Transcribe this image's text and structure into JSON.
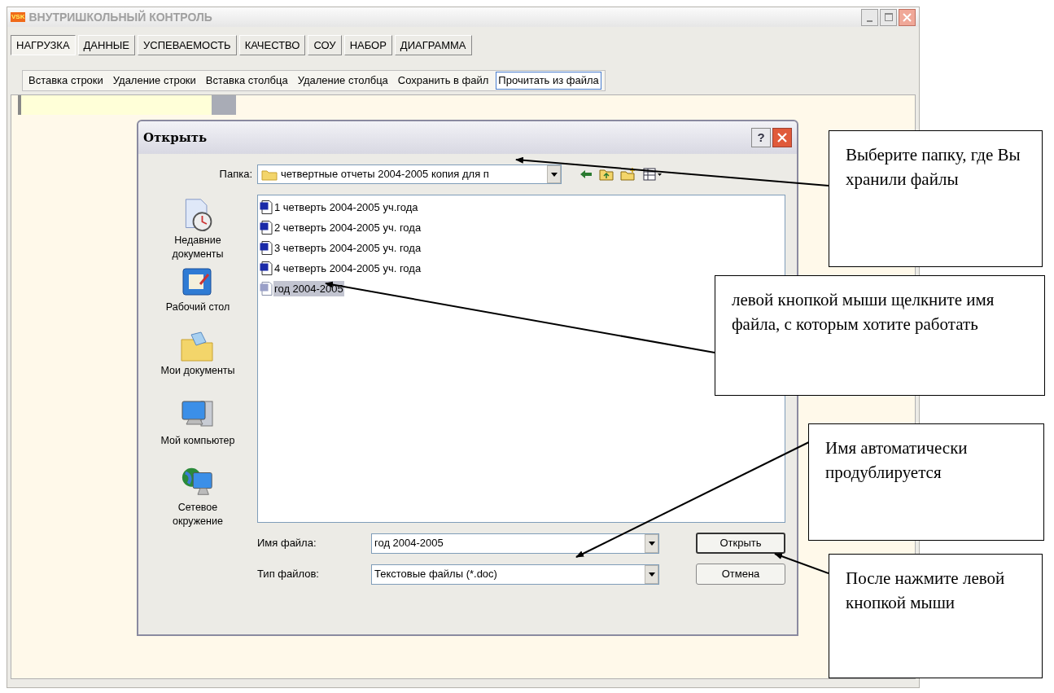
{
  "app": {
    "logo": "VSK",
    "title": "ВНУТРИШКОЛЬНЫЙ КОНТРОЛЬ",
    "tabs": [
      {
        "label": "НАГРУЗКА",
        "selected": true
      },
      {
        "label": "ДАННЫЕ",
        "selected": false
      },
      {
        "label": "УСПЕВАЕМОСТЬ",
        "selected": false
      },
      {
        "label": "КАЧЕСТВО",
        "selected": false
      },
      {
        "label": "СОУ",
        "selected": false
      },
      {
        "label": "НАБОР",
        "selected": false
      },
      {
        "label": "ДИАГРАММА",
        "selected": false
      }
    ],
    "toolbar": [
      {
        "label": "Вставка строки",
        "selected": false
      },
      {
        "label": "Удаление строки",
        "selected": false
      },
      {
        "label": "Вставка столбца",
        "selected": false
      },
      {
        "label": "Удаление столбца",
        "selected": false
      },
      {
        "label": "Сохранить в файл",
        "selected": false
      },
      {
        "label": "Прочитать из файла",
        "selected": true
      }
    ]
  },
  "dialog": {
    "title": "Открыть",
    "help": "?",
    "folder_label": "Папка:",
    "folder": "четвертные отчеты 2004-2005 копия для п",
    "places": [
      {
        "kind": "recent",
        "label": "Недавние документы"
      },
      {
        "kind": "desktop",
        "label": "Рабочий стол"
      },
      {
        "kind": "documents",
        "label": "Мои документы"
      },
      {
        "kind": "computer",
        "label": "Мой компьютер"
      },
      {
        "kind": "network",
        "label": "Сетевое окружение"
      }
    ],
    "files": [
      {
        "name": "1 четверть 2004-2005 уч.года",
        "selected": false
      },
      {
        "name": "2 четверть 2004-2005 уч. года",
        "selected": false
      },
      {
        "name": "3 четверть 2004-2005 уч. года",
        "selected": false
      },
      {
        "name": "4 четверть 2004-2005 уч. года",
        "selected": false
      },
      {
        "name": "год 2004-2005",
        "selected": true
      }
    ],
    "filename_label": "Имя файла:",
    "filename": "год 2004-2005",
    "filetype_label": "Тип файлов:",
    "filetype": "Текстовые файлы (*.doc)",
    "buttons": [
      "Открыть",
      "Отмена"
    ]
  },
  "callouts": [
    {
      "text": "Выберите папку, где Вы хранили файлы"
    },
    {
      "text": "левой кнопкой мыши щелкните имя файла, с которым хотите работать"
    },
    {
      "text": "Имя автоматически продублируется"
    },
    {
      "text": "После нажмите левой кнопкой мыши"
    }
  ]
}
